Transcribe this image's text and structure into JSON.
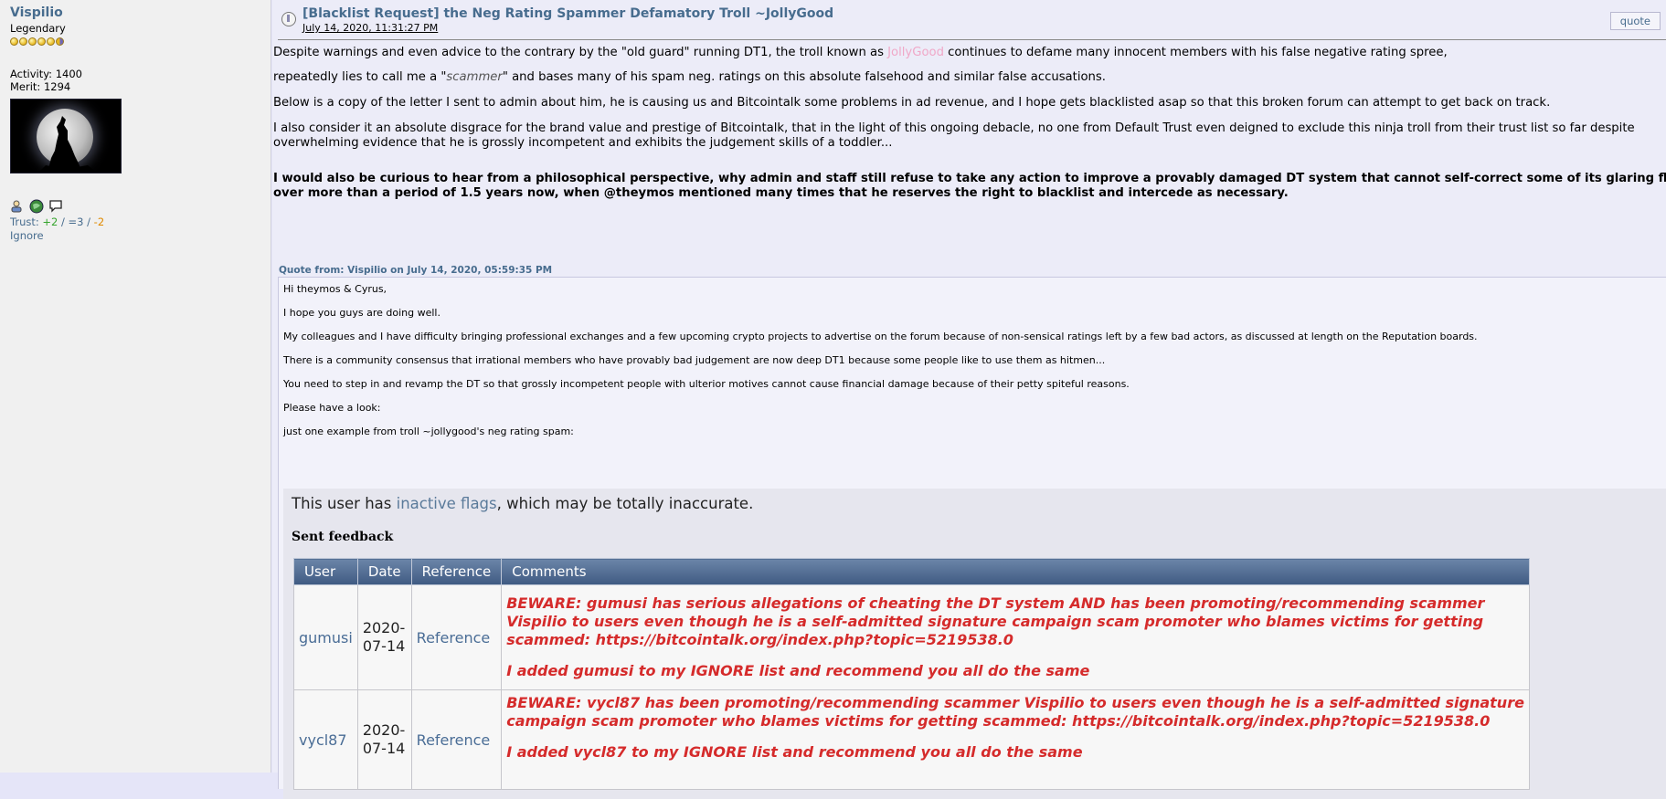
{
  "poster": {
    "name": "Vispilio",
    "rank": "Legendary",
    "activity": "Activity: 1400",
    "merit": "Merit: 1294",
    "trust_label": "Trust: ",
    "trust_pos": "+2",
    "trust_sep1": " / ",
    "trust_mid": "=3",
    "trust_sep2": " / ",
    "trust_neg": "-2",
    "ignore": "Ignore",
    "badge_icons": [
      "profile-icon",
      "website-globe-icon",
      "message-bubble-icon"
    ]
  },
  "post": {
    "title": "[Blacklist Request] the Neg Rating Spammer Defamatory Troll ~JollyGood",
    "date": "July 14, 2020, 11:31:27 PM",
    "quote_button": "quote",
    "p1a": "Despite warnings and even advice to the contrary by the \"old guard\" running DT1, the troll known as ",
    "p1_name": "JollyGood",
    "p1b": " continues to defame many innocent members with his false negative rating spree,",
    "p2a": "repeatedly lies to call me a \"",
    "p2_em": "scammer",
    "p2b": "\" and bases many of his spam neg. ratings on this absolute falsehood and similar false accusations.",
    "p3": "Below is a copy of the letter I sent to admin about him, he is causing us and Bitcointalk some problems in ad revenue, and I hope gets blacklisted asap so that this broken forum can attempt to get back on track.",
    "p4a": "I also consider it an absolute disgrace for the brand value and prestige of Bitcointalk, that in the light of this ongoing debacle, no one from Default Trust even deigned to exclude this ninja troll from their trust list so far despite",
    "p4b": "overwhelming evidence that he is grossly incompetent and exhibits the judgement skills of a toddler...",
    "p5a": "I would also be curious to hear from a philosophical perspective, why admin and staff still refuse to take any action to improve a provably damaged DT system that cannot self-correct some of its glaring flaws",
    "p5b": "over more than a period of 1.5 years now, when @theymos mentioned many times that he reserves the right to blacklist and intercede as necessary."
  },
  "quote": {
    "header": "Quote from: Vispilio on July 14, 2020, 05:59:35 PM",
    "lines": [
      "Hi theymos & Cyrus,",
      "I hope you guys are doing well.",
      "My colleagues and I have difficulty bringing professional exchanges and a few upcoming crypto projects to advertise on the forum because of non-sensical ratings left by a few bad actors, as discussed at length on the Reputation boards.",
      "There is a community consensus that irrational members who have provably bad judgement are now deep DT1 because some people like to use them as hitmen...",
      "You need to step in and revamp the DT so that grossly incompetent people with ulterior motives cannot cause financial damage because of their petty spiteful reasons.",
      "Please have a look:",
      "just one example from troll ~jollygood's neg rating spam:"
    ]
  },
  "flags": {
    "prefix": "This user has ",
    "link": "inactive flags",
    "suffix": ", which may be totally inaccurate.",
    "sent_feedback": "Sent feedback",
    "columns": [
      "User",
      "Date",
      "Reference",
      "Comments"
    ],
    "rows": [
      {
        "user": "gumusi",
        "date_line1": "2020-",
        "date_line2": "07-14",
        "reference": "Reference",
        "comment_lines": [
          "BEWARE: gumusi has serious allegations of cheating the DT system AND has been promoting/recommending scammer",
          "Vispilio to users even though he is a self-admitted signature campaign scam promoter who blames victims for getting",
          "scammed: https://bitcointalk.org/index.php?topic=5219538.0",
          "",
          "I added gumusi to my IGNORE list and recommend you all do the same"
        ]
      },
      {
        "user": "vycl87",
        "date_line1": "2020-",
        "date_line2": "07-14",
        "reference": "Reference",
        "comment_lines": [
          "BEWARE: vycl87 has been promoting/recommending scammer Vispilio to users even though he is a self-admitted signature",
          "campaign scam promoter who blames victims for getting scammed: https://bitcointalk.org/index.php?topic=5219538.0",
          "",
          "I added vycl87 to my IGNORE list and recommend you all do the same"
        ]
      }
    ]
  }
}
